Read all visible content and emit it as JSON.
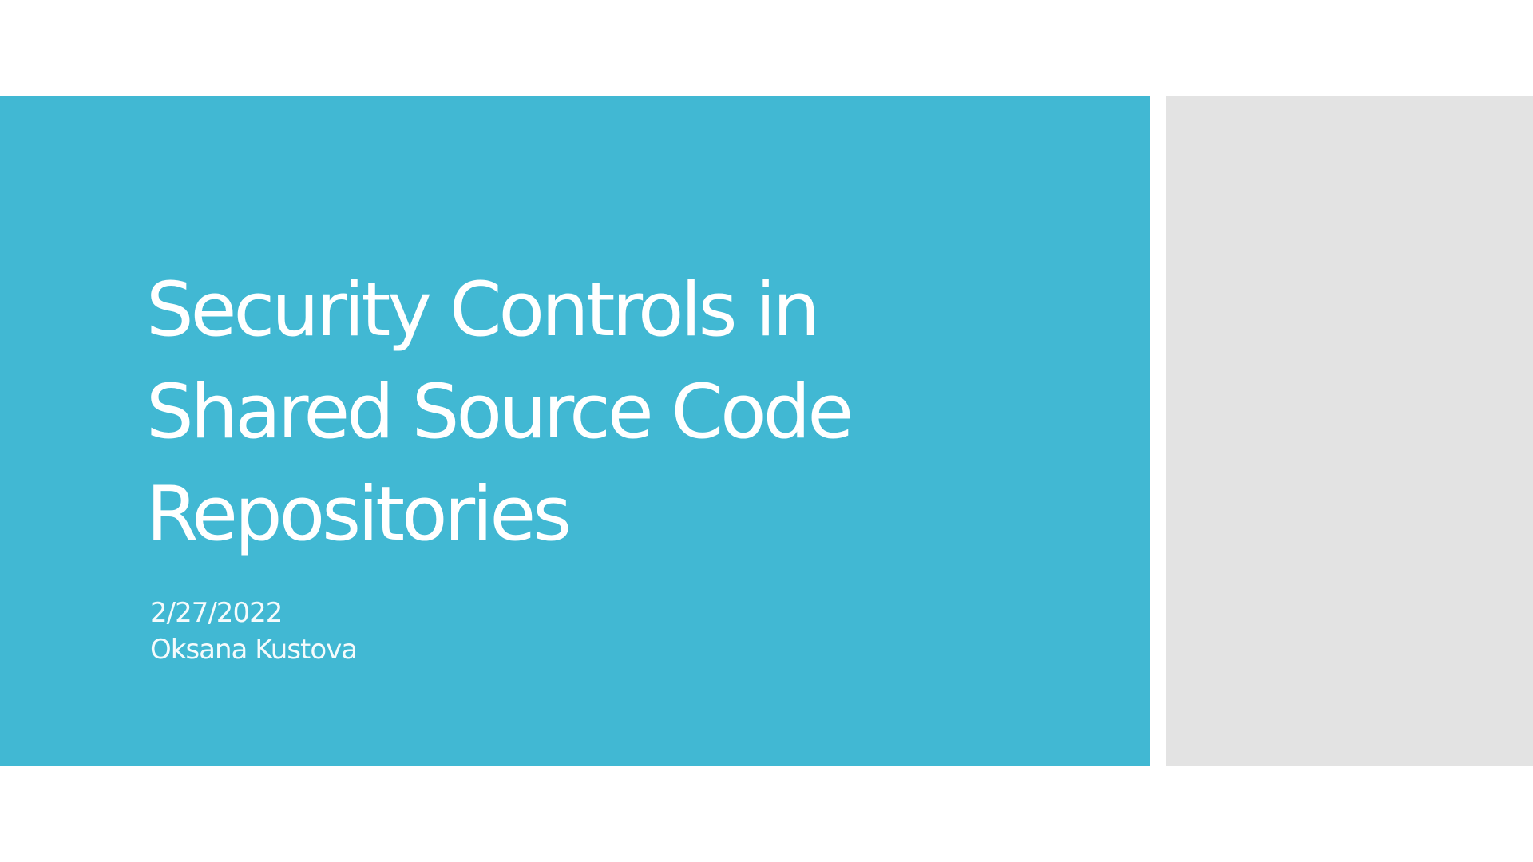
{
  "slide": {
    "title_lines": [
      "Security Controls in",
      "Shared Source Code",
      "Repositories"
    ],
    "date": "2/27/2022",
    "author": "Oksana Kustova"
  },
  "colors": {
    "title_panel": "#41B8D3",
    "side_panel": "#E3E3E3",
    "background": "#FFFFFF",
    "text": "#FFFFFF"
  }
}
